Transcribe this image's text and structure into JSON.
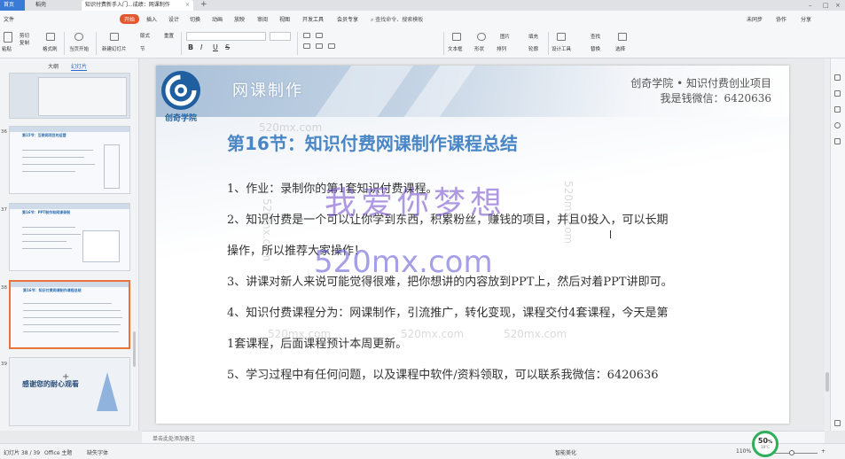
{
  "tabs": {
    "home": "首页",
    "t2": "稻壳",
    "active": "知识付费新手入门...成绩：网课制作",
    "active_close": "×",
    "add": "+"
  },
  "window": {
    "min": "–",
    "max": "□",
    "close": "×"
  },
  "menu": {
    "file": "文件",
    "start": "开始",
    "items": [
      "插入",
      "设计",
      "切换",
      "动画",
      "放映",
      "审阅",
      "视图",
      "开发工具",
      "会员专享"
    ],
    "search": "查找命令、搜索模板",
    "right": [
      "未同步",
      "协作",
      "分享"
    ]
  },
  "toolbar": {
    "paste": "粘贴",
    "cut": "剪切",
    "copy": "复制",
    "format_painter": "格式刷",
    "start_from": "当页开始",
    "new_slide": "新建幻灯片",
    "layout": "版式",
    "section": "节",
    "reset": "重置",
    "bold": "B",
    "italic": "I",
    "underline": "U",
    "strike": "S",
    "textbox": "文本框",
    "shape": "形状",
    "arrange": "排列",
    "outline": "轮廓",
    "replace": "替换",
    "select": "选择",
    "find": "查找",
    "design_tools": "设计工具",
    "picture": "图片",
    "fill": "填充"
  },
  "left_pane": {
    "tab_outline": "大纲",
    "tab_slides": "幻灯片",
    "add_button": "+",
    "thumbs": [
      {
        "num": "",
        "title": ""
      },
      {
        "num": "36",
        "title": "第15节：互联网项目的运营"
      },
      {
        "num": "37",
        "title": "第16节：PPT制作和网课录制"
      },
      {
        "num": "38",
        "title": "第16节：知识付费网课制作课程总结"
      },
      {
        "num": "39",
        "title": "感谢您的耐心观看"
      }
    ]
  },
  "slide": {
    "logo_text": "创奇学院",
    "section_name": "网课制作",
    "org_line1": "创奇学院 • 知识付费创业项目",
    "org_line2": "我是钱微信：6420636",
    "heading": "第16节：知识付费网课制作课程总结",
    "lines": [
      "1、作业：录制你的第1套知识付费课程。",
      "2、知识付费是一个可以让你学到东西，积累粉丝，赚钱的项目，并且0投入，可以长期",
      "操作，所以推荐大家操作！",
      "3、讲课对新人来说可能觉得很难，把你想讲的内容放到PPT上，然后对着PPT讲即可。",
      "4、知识付费课程分为：网课制作，引流推广，转化变现，课程交付4套课程，今天是第",
      "1套课程，后面课程预计本周更新。",
      "5、学习过程中有任何问题，以及课程中软件/资料领取，可以联系我微信：6420636"
    ],
    "watermark_big1": "我爱你梦想",
    "watermark_big2": "520mx.com",
    "watermark_small": "520mx.com"
  },
  "notes": {
    "placeholder": "单击此处添加备注"
  },
  "status": {
    "slide_pos": "幻灯片 38 / 39",
    "theme": "Office 主题",
    "font_missing": "缺失字体",
    "smart_beautify": "智能美化",
    "zoom": "110%",
    "zoom_minus": "–",
    "zoom_plus": "+"
  },
  "badge": {
    "pct": "50",
    "unit": "%",
    "temp": "39°C"
  },
  "colors": {
    "accent": "#e4572e",
    "heading": "#4a86c5",
    "selection": "#e8743b",
    "badge_ring": "#2eaf5a"
  }
}
